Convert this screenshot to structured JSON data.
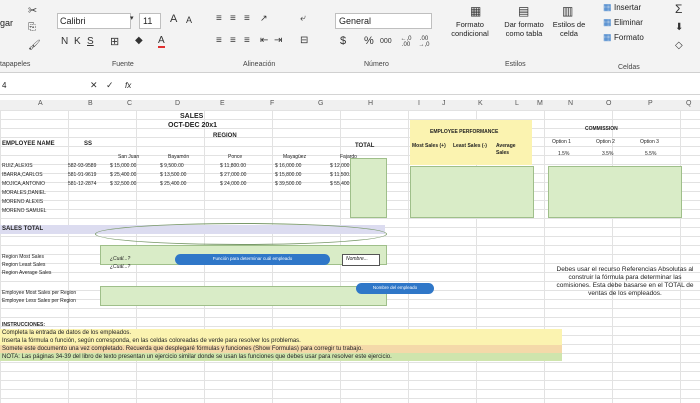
{
  "ribbon": {
    "font_name": "Calibri",
    "font_size": "11",
    "font_grow": "A",
    "font_shrink": "A",
    "bold": "N",
    "italic": "K",
    "underline": "S",
    "font_color_letter": "A",
    "number_format": "General",
    "currency": "$",
    "percent": "%",
    "thousands": "000",
    "dec_inc": "←,0 .00",
    "dec_dec": ".00 →,0",
    "clipboard_label": "tapapeles",
    "font_label": "Fuente",
    "align_label": "Alineación",
    "number_label": "Número",
    "styles_label": "Estilos",
    "cells_label": "Celdas",
    "cond_format": "Formato condicional",
    "table_format": "Dar formato como tabla",
    "cell_styles": "Estilos de celda",
    "insert": "Insertar",
    "delete": "Eliminar",
    "format": "Formato",
    "paste_partial": "gar"
  },
  "formula_bar": {
    "name_box": "4",
    "fx": "fx"
  },
  "columns": [
    "A",
    "B",
    "C",
    "D",
    "E",
    "F",
    "G",
    "H",
    "I",
    "J",
    "K",
    "L",
    "M",
    "N",
    "O",
    "P",
    "Q"
  ],
  "sheet": {
    "title1": "SALES",
    "title2": "OCT-DEC 20x1",
    "region": "REGION",
    "emp_name_hdr": "EMPLOYEE NAME",
    "ss_hdr": "SS",
    "total_hdr": "TOTAL",
    "regions": [
      "San Juan",
      "Bayamón",
      "Ponce",
      "Mayagüez",
      "Fajardo"
    ],
    "employees": [
      "RUIZ,ALEXIS",
      "IBARRA,CARLOS",
      "MOJICA,ANTONIO",
      "MORALES,DANIEL",
      "MORENO ALEXIS",
      "MORENO SAMUEL"
    ],
    "rows": [
      {
        "ss": "582-93-9589",
        "vals": [
          "$ 15,000.00",
          "$ 9,500.00",
          "$ 11,800.00",
          "$ 16,000.00",
          "$ 12,000.00"
        ]
      },
      {
        "ss": "581-91-9619",
        "vals": [
          "$ 25,400.00",
          "$ 13,500.00",
          "$ 27,000.00",
          "$ 15,800.00",
          "$ 11,500.00"
        ]
      },
      {
        "ss": "581-12-2874",
        "vals": [
          "$ 32,500.00",
          "$ 25,400.00",
          "$ 24,000.00",
          "$ 39,500.00",
          "$ 55,400.00"
        ]
      }
    ],
    "sales_total": "SALES TOTAL",
    "summary_labels": [
      "Region Most Sales",
      "Region Least Sales",
      "Region Average Sales"
    ],
    "formula_hint1": "¿Cuál...?",
    "formula_hint2": "¿Cuál...?",
    "employee_labels": [
      "Employee Most Sales per Region",
      "Employee Less Sales per Region"
    ],
    "perf_title": "EMPLOYEE PERFORMANCE",
    "perf_cols": [
      "Most Sales (+)",
      "Least Sales (-)",
      "Average Sales"
    ],
    "commission_title": "COMMISSION",
    "options": [
      "Option 1",
      "Option 2",
      "Option 3"
    ],
    "option_values": [
      "1.5%",
      "3.5%",
      "5.5%"
    ],
    "pill_func": "Función para determinar cuál empleado",
    "callout_name": "Nombre...",
    "pill_name": "Nombre del empleado",
    "note": "Debes usar el recurso Referencias Absolutas al construir la fórmula para determinar las comisiones. Esta debe basarse en el TOTAL de ventas de los empleados."
  },
  "instructions": {
    "header": "INSTRUCCIONES:",
    "line1": "Completa la entrada de datos de los empleados.",
    "line2": "Inserta la fórmula o función, según corresponda, en las celdas coloreadas de verde para resolver los problemas.",
    "line3": "Somete este documento una vez completado. Recuerda que desplegaré fórmulas y funciones (Show Formulas) para corregir tu trabajo.",
    "line4": "NOTA: Las páginas 34-39 del libro de texto presentan un ejercicio similar donde se usan las funciones que debes usar para resolver este ejercicio."
  },
  "colors": {
    "green_fill": "#d9ecc7",
    "yellow_fill": "#fbf3b0",
    "blue_pill": "#2f77c8",
    "lavender": "#dcdcf0"
  }
}
